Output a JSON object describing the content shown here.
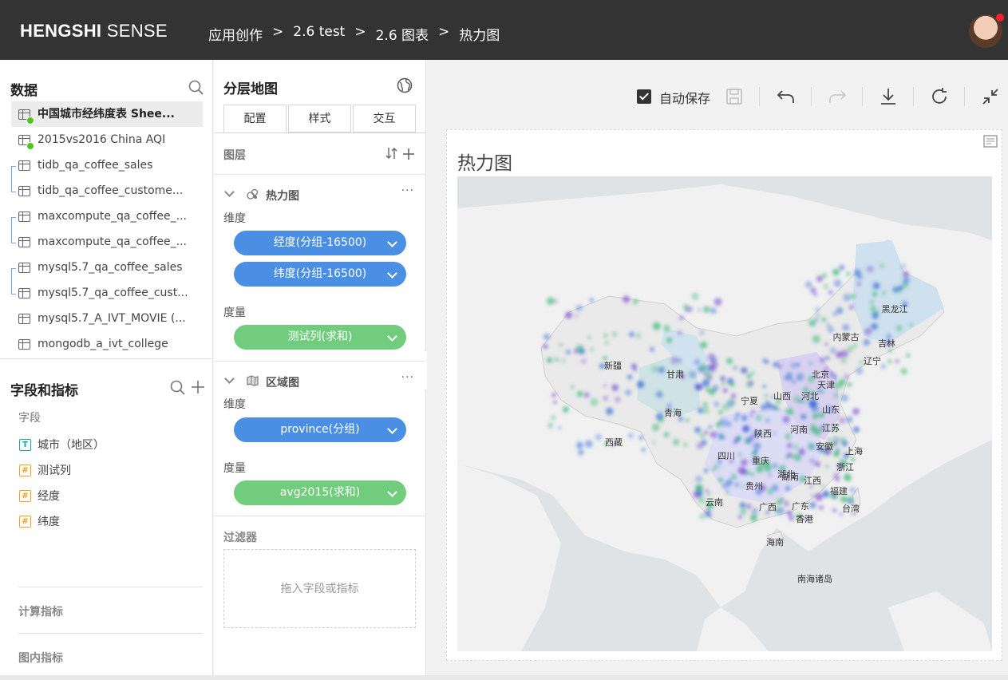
{
  "header": {
    "logo_bold": "HENGSHI",
    "logo_light": " SENSE",
    "breadcrumbs": [
      "应用创作",
      "2.6 test",
      "2.6 图表",
      "热力图"
    ],
    "separator": ">"
  },
  "data_panel": {
    "title": "数据",
    "datasets": [
      {
        "label": "中国城市经纬度表 Shee...",
        "active": true,
        "status": "ok"
      },
      {
        "label": "2015vs2016 China AQI",
        "status": "ok"
      },
      {
        "label": "tidb_qa_coffee_sales"
      },
      {
        "label": "tidb_qa_coffee_custome..."
      },
      {
        "label": "maxcompute_qa_coffee_..."
      },
      {
        "label": "maxcompute_qa_coffee_..."
      },
      {
        "label": "mysql5.7_qa_coffee_sales"
      },
      {
        "label": "mysql5.7_qa_coffee_cust..."
      },
      {
        "label": "mysql5.7_A_IVT_MOVIE (..."
      },
      {
        "label": "mongodb_a_ivt_college"
      }
    ]
  },
  "fields_panel": {
    "title": "字段和指标",
    "fields_label": "字段",
    "fields": [
      {
        "type": "T",
        "label": "城市（地区）"
      },
      {
        "type": "#",
        "label": "测试列"
      },
      {
        "type": "#",
        "label": "经度"
      },
      {
        "type": "#",
        "label": "纬度"
      }
    ],
    "calc_metrics": "计算指标",
    "chart_metrics": "图内指标"
  },
  "config": {
    "title": "分层地图",
    "tabs": [
      "配置",
      "样式",
      "交互"
    ],
    "layers_label": "图层",
    "layers": [
      {
        "name": "热力图",
        "dimension_label": "维度",
        "dimensions": [
          "经度(分组-16500)",
          "纬度(分组-16500)"
        ],
        "measure_label": "度量",
        "measures": [
          "测试列(求和)"
        ]
      },
      {
        "name": "区域图",
        "dimension_label": "维度",
        "dimensions": [
          "province(分组)"
        ],
        "measure_label": "度量",
        "measures": [
          "avg2015(求和)"
        ]
      }
    ],
    "more": "···",
    "filter_label": "过滤器",
    "filter_placeholder": "拖入字段或指标"
  },
  "toolbar": {
    "autosave_label": "自动保存",
    "autosave_checked": true
  },
  "chart": {
    "title": "热力图",
    "map_labels": [
      "黑龙江",
      "吉林",
      "辽宁",
      "内蒙古",
      "北京",
      "天津",
      "河北",
      "山西",
      "山东",
      "宁夏",
      "甘肃",
      "新疆",
      "青海",
      "西藏",
      "陕西",
      "河南",
      "江苏",
      "安徽",
      "上海",
      "浙江",
      "四川",
      "重庆",
      "湖北",
      "湖南",
      "江西",
      "贵州",
      "云南",
      "广西",
      "广东",
      "福建",
      "台湾",
      "香港",
      "海南",
      "南海诸岛"
    ]
  },
  "colors": {
    "header_bg": "#333333",
    "pill_blue": "#4a8fe3",
    "pill_green": "#72cc7e",
    "status_ok": "#52c41a",
    "avatar_dot": "#f5222d"
  }
}
